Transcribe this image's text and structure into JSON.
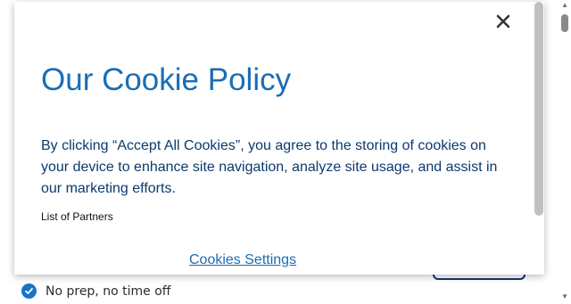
{
  "background": {
    "feature_item": "No prep, no time off"
  },
  "modal": {
    "title": "Our Cookie Policy",
    "body": "By clicking “Accept All Cookies”, you agree to the storing of cookies on your device to enhance site navigation, analyze site usage, and assist in our marketing efforts.",
    "partners_link": "List of Partners",
    "settings_link": "Cookies Settings",
    "close_icon": "close-icon"
  },
  "colors": {
    "title": "#1a6db5",
    "body_text": "#0b3a6e",
    "link": "#1a6db5",
    "check_badge": "#1a73c8"
  }
}
